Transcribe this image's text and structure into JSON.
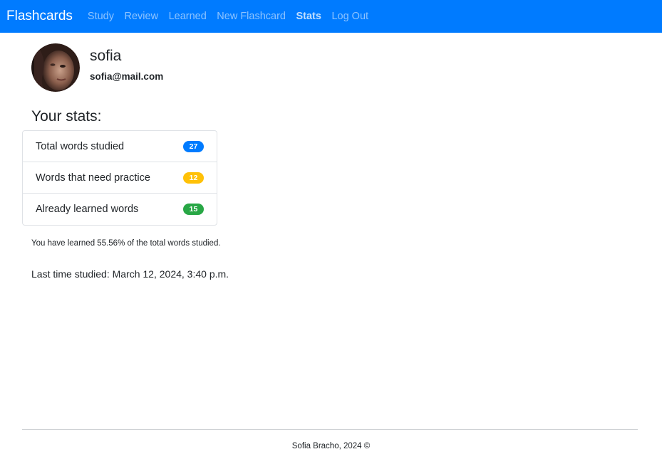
{
  "navbar": {
    "brand": "Flashcards",
    "links": [
      {
        "label": "Study"
      },
      {
        "label": "Review"
      },
      {
        "label": "Learned"
      },
      {
        "label": "New Flashcard"
      },
      {
        "label": "Stats"
      },
      {
        "label": "Log Out"
      }
    ],
    "active": "Stats",
    "color": "#007bff"
  },
  "profile": {
    "username": "sofia",
    "email": "sofia@mail.com",
    "avatar_icon": "user-avatar-photo"
  },
  "stats": {
    "title": "Your stats:",
    "items": [
      {
        "label": "Total words studied",
        "count": "27",
        "badge_color": "#007bff"
      },
      {
        "label": "Words that need practice",
        "count": "12",
        "badge_color": "#ffc107"
      },
      {
        "label": "Already learned words",
        "count": "15",
        "badge_color": "#28a745"
      }
    ],
    "summary": "You have learned 55.56% of the total words studied.",
    "last_studied": "Last time studied: March 12, 2024, 3:40 p.m."
  },
  "footer": {
    "text": "Sofia Bracho, 2024 ©"
  }
}
